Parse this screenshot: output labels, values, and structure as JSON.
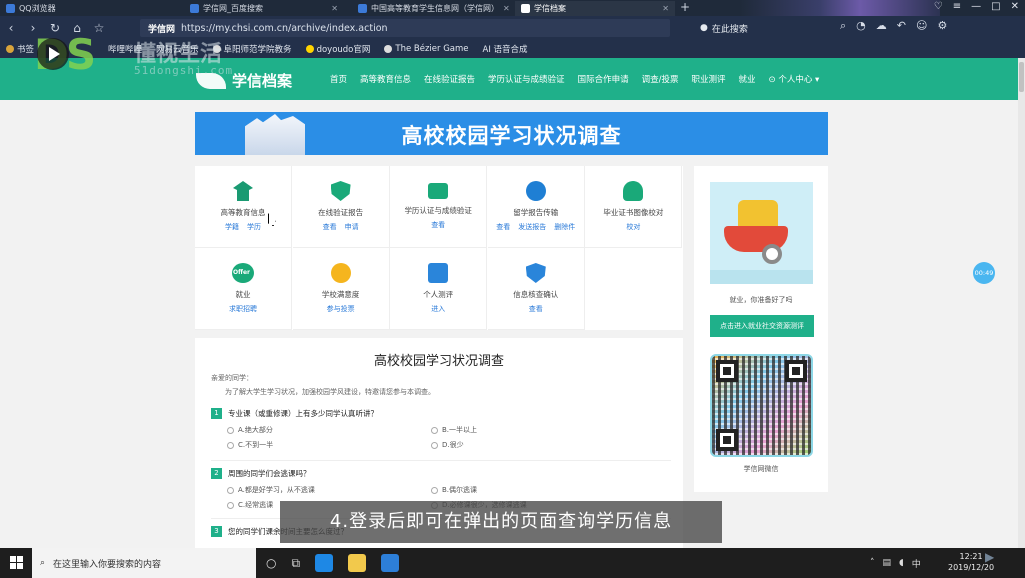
{
  "browser": {
    "tabs": [
      {
        "label": "QQ浏览器",
        "active": false
      },
      {
        "label": "学信网_百度搜索",
        "active": false
      },
      {
        "label": "中国高等教育学生信息网（学信网）",
        "active": false
      },
      {
        "label": "学信档案",
        "active": true
      }
    ],
    "url_site": "学信网",
    "url": "https://my.chsi.com.cn/archive/index.action",
    "search_placeholder": "在此搜索",
    "bookmarks": [
      "书签",
      "哔哩哔哩",
      "网易云音乐",
      "阜阳师范学院教务",
      "doyoudo官网",
      "The Bézier Game",
      "AI 语音合成"
    ]
  },
  "watermark": {
    "logo": "DS",
    "cn": "懂视生活",
    "en": "51dongshi.com"
  },
  "site": {
    "logo": "学信档案",
    "nav": [
      "首页",
      "高等教育信息",
      "在线验证报告",
      "学历认证与成绩验证",
      "国际合作申请",
      "调查/投票",
      "职业测评",
      "就业",
      "个人中心"
    ]
  },
  "banner_title": "高校校园学习状况调查",
  "services": [
    {
      "label": "高等教育信息",
      "icon": "graduation-cap-icon",
      "cls": "grad",
      "links": [
        "学籍",
        "学历"
      ]
    },
    {
      "label": "在线验证报告",
      "icon": "shield-check-icon",
      "cls": "shield",
      "links": [
        "查看",
        "申请"
      ]
    },
    {
      "label": "学历认证与成绩验证",
      "icon": "id-card-icon",
      "cls": "card",
      "links": [
        "查看"
      ]
    },
    {
      "label": "留学报告传输",
      "icon": "globe-icon",
      "cls": "globe",
      "links": [
        "查看",
        "发送报告",
        "删除件"
      ]
    },
    {
      "label": "毕业证书图像校对",
      "icon": "user-check-icon",
      "cls": "user",
      "links": [
        "校对"
      ]
    },
    {
      "label": "就业",
      "icon": "offer-icon",
      "cls": "offer",
      "links": [
        "求职招聘"
      ]
    },
    {
      "label": "学校满意度",
      "icon": "smile-icon",
      "cls": "smile",
      "links": [
        "参与投票"
      ]
    },
    {
      "label": "个人测评",
      "icon": "checklist-icon",
      "cls": "check",
      "links": [
        "进入"
      ]
    },
    {
      "label": "信息核查确认",
      "icon": "person-shield-icon",
      "cls": "person",
      "links": [
        "查看"
      ]
    }
  ],
  "survey": {
    "title": "高校校园学习状况调查",
    "greeting": "亲爱的同学：",
    "intro": "为了解大学生学习状况，加强校园学风建设，特邀请您参与本调查。",
    "questions": [
      {
        "num": "1",
        "text": "专业课（或重修课）上有多少同学认真听讲？",
        "options": [
          "A.绝大部分",
          "B.一半以上",
          "C.不到一半",
          "D.很少"
        ]
      },
      {
        "num": "2",
        "text": "周围的同学们会逃课吗？",
        "options": [
          "A.都是好学习，从不逃课",
          "B.偶尔逃课",
          "C.经常逃课",
          "D.必修课很少，选修课逃课"
        ]
      },
      {
        "num": "3",
        "text": "您的同学们课余时间主要怎么度过？",
        "options": []
      }
    ]
  },
  "side": {
    "caption": "就业，你准备好了吗",
    "button": "点击进入就业社交资源测评",
    "qr_label": "学信网微信"
  },
  "timer": "00:49",
  "subtitle": "4.登录后即可在弹出的页面查询学历信息",
  "taskbar": {
    "search_placeholder": "在这里输入你要搜索的内容",
    "ime": "中",
    "time": "12:21",
    "date": "2019/12/20"
  },
  "colors": {
    "brand_green": "#1fb08a",
    "banner_blue": "#2b8ee6",
    "link_blue": "#2a7ad8"
  }
}
